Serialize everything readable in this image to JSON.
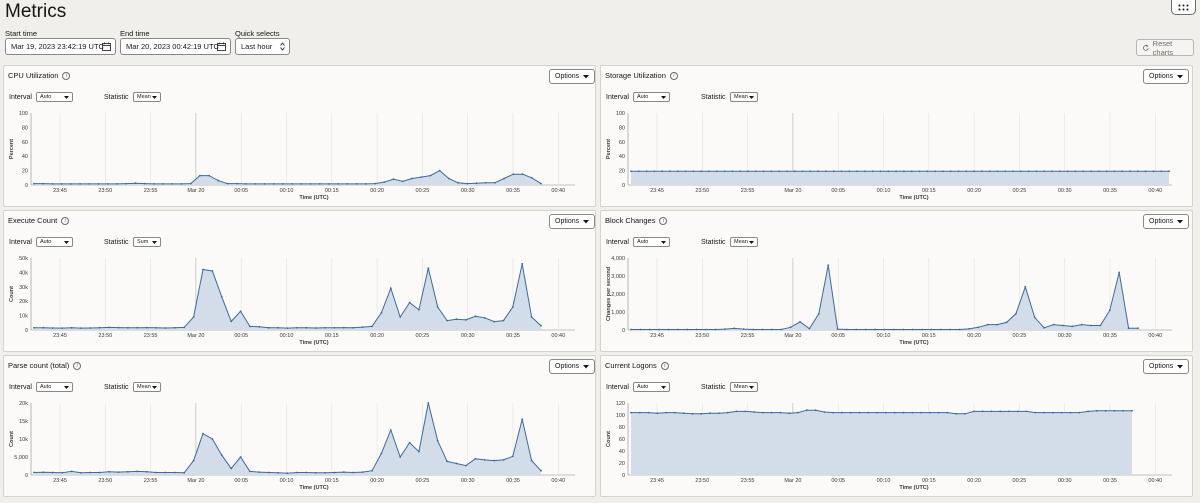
{
  "page": {
    "title": "Metrics"
  },
  "filters": {
    "start_label": "Start time",
    "start_value": "Mar 19, 2023 23:42:19 UTC",
    "end_label": "End time",
    "end_value": "Mar 20, 2023 00:42:19 UTC",
    "quick_label": "Quick selects",
    "quick_value": "Last hour",
    "reset_label": "Reset charts"
  },
  "time_axis": {
    "title": "Time (UTC)",
    "ticks": [
      "23:45",
      "23:50",
      "23:55",
      "Mar 20",
      "00:05",
      "00:10",
      "00:15",
      "00:20",
      "00:25",
      "00:30",
      "00:35",
      "00:40"
    ]
  },
  "panels": [
    {
      "id": "cpu",
      "title": "CPU Utilization",
      "options_label": "Options",
      "interval_label": "Interval",
      "interval_value": "Auto",
      "statistic_label": "Statistic",
      "statistic_value": "Mean",
      "chart_data": {
        "type": "area",
        "ylabel": "Percent",
        "ylim": [
          0,
          100
        ],
        "yticks": [
          "100",
          "80",
          "60",
          "40",
          "20",
          "0"
        ],
        "yvals": [
          100,
          80,
          60,
          40,
          20,
          0
        ],
        "values": [
          2,
          2,
          1.5,
          1.5,
          1.5,
          1.5,
          1.5,
          1.5,
          1.5,
          1.5,
          2,
          2.5,
          2,
          1.5,
          1.5,
          1.5,
          1.5,
          2,
          13,
          13,
          6,
          2,
          2,
          1.5,
          1.5,
          1.5,
          1.5,
          1.5,
          1.5,
          1.5,
          1.5,
          1.5,
          1.5,
          1.5,
          1.5,
          1.5,
          1.5,
          2,
          4,
          8,
          5,
          9,
          11,
          13,
          20,
          9,
          3,
          2,
          2.5,
          3,
          3,
          9,
          15,
          15,
          10,
          2
        ]
      }
    },
    {
      "id": "storage",
      "title": "Storage Utilization",
      "options_label": "Options",
      "interval_label": "Interval",
      "interval_value": "Auto",
      "statistic_label": "Statistic",
      "statistic_value": "Mean",
      "chart_data": {
        "type": "area",
        "ylabel": "Percent",
        "ylim": [
          0,
          100
        ],
        "yticks": [
          "100",
          "80",
          "60",
          "40",
          "20",
          "0"
        ],
        "yvals": [
          100,
          80,
          60,
          40,
          20,
          0
        ],
        "values": [
          19,
          19,
          19,
          19,
          19,
          19,
          19,
          19,
          19,
          19,
          19,
          19,
          19,
          19,
          19,
          19,
          19,
          19,
          19,
          19,
          19,
          19,
          19,
          19,
          19,
          19,
          19,
          19,
          19,
          19,
          19,
          19,
          19,
          19,
          19,
          19,
          19,
          19,
          19,
          19,
          19,
          19,
          19,
          19,
          19,
          19,
          19,
          19,
          19,
          19,
          19,
          19,
          19,
          19,
          19,
          19,
          19,
          19,
          19,
          19,
          19,
          19,
          19,
          19,
          19,
          19,
          19,
          19,
          19,
          19
        ]
      }
    },
    {
      "id": "execute",
      "title": "Execute Count",
      "options_label": "Options",
      "interval_label": "Interval",
      "interval_value": "Auto",
      "statistic_label": "Statistic",
      "statistic_value": "Sum",
      "chart_data": {
        "type": "area",
        "ylabel": "Count",
        "ylim": [
          0,
          50000
        ],
        "yticks": [
          "50k",
          "40k",
          "30k",
          "20k",
          "10k",
          "0"
        ],
        "yvals": [
          50000,
          40000,
          30000,
          20000,
          10000,
          0
        ],
        "values": [
          1500,
          1600,
          1400,
          1300,
          1500,
          1300,
          1400,
          1600,
          1800,
          1700,
          1500,
          1600,
          1700,
          1500,
          1400,
          1500,
          1800,
          9000,
          42000,
          41000,
          23000,
          6000,
          13000,
          2500,
          2200,
          1500,
          1500,
          1300,
          1500,
          1500,
          1400,
          1500,
          1500,
          1700,
          1500,
          2000,
          2500,
          12000,
          29000,
          9000,
          19000,
          14000,
          43000,
          16000,
          6500,
          7500,
          7000,
          9500,
          8500,
          5800,
          6500,
          16000,
          46000,
          9000,
          3000
        ]
      }
    },
    {
      "id": "block",
      "title": "Block Changes",
      "options_label": "Options",
      "interval_label": "Interval",
      "interval_value": "Auto",
      "statistic_label": "Statistic",
      "statistic_value": "Mean",
      "chart_data": {
        "type": "area",
        "ylabel": "Changes per second",
        "ylim": [
          0,
          4000
        ],
        "yticks": [
          "4,000",
          "3,000",
          "2,000",
          "1,000",
          "0"
        ],
        "yvals": [
          4000,
          3000,
          2000,
          1000,
          0
        ],
        "values": [
          30,
          30,
          30,
          30,
          30,
          30,
          30,
          30,
          30,
          30,
          50,
          90,
          50,
          30,
          30,
          30,
          30,
          150,
          450,
          80,
          900,
          3600,
          50,
          30,
          30,
          30,
          30,
          30,
          30,
          30,
          30,
          30,
          30,
          30,
          30,
          30,
          60,
          150,
          300,
          300,
          420,
          900,
          2400,
          700,
          120,
          300,
          250,
          200,
          300,
          250,
          250,
          1100,
          3200,
          100,
          100
        ]
      }
    },
    {
      "id": "parse",
      "title": "Parse count (total)",
      "options_label": "Options",
      "interval_label": "Interval",
      "interval_value": "Auto",
      "statistic_label": "Statistic",
      "statistic_value": "Mean",
      "chart_data": {
        "type": "area",
        "ylabel": "Count",
        "ylim": [
          0,
          20000
        ],
        "yticks": [
          "20k",
          "15k",
          "10k",
          "5,000",
          "0"
        ],
        "yvals": [
          20000,
          15000,
          10000,
          5000,
          0
        ],
        "values": [
          700,
          750,
          700,
          650,
          1000,
          600,
          700,
          700,
          900,
          800,
          900,
          1000,
          900,
          700,
          700,
          700,
          600,
          4000,
          11500,
          10000,
          5500,
          1800,
          5000,
          1000,
          800,
          700,
          600,
          500,
          700,
          700,
          600,
          600,
          700,
          800,
          700,
          800,
          1200,
          6000,
          12500,
          5000,
          9000,
          6500,
          20000,
          9500,
          3800,
          3200,
          2600,
          4500,
          4200,
          4000,
          4200,
          5200,
          15500,
          4000,
          1200
        ]
      }
    },
    {
      "id": "logons",
      "title": "Current Logons",
      "options_label": "Options",
      "interval_label": "Interval",
      "interval_value": "Auto",
      "statistic_label": "Statistic",
      "statistic_value": "Mean",
      "chart_data": {
        "type": "area",
        "ylabel": "Count",
        "ylim": [
          0,
          120
        ],
        "yticks": [
          "120",
          "100",
          "80",
          "60",
          "40",
          "20",
          "0"
        ],
        "yvals": [
          120,
          100,
          80,
          60,
          40,
          20,
          0
        ],
        "values": [
          104,
          104,
          104,
          103,
          104,
          104,
          103,
          102,
          102,
          103,
          103,
          104,
          106,
          106,
          105,
          104,
          104,
          104,
          103,
          104,
          108,
          108,
          105,
          104,
          104,
          104,
          104,
          104,
          104,
          104,
          104,
          104,
          104,
          104,
          104,
          104,
          104,
          102,
          102,
          106,
          106,
          106,
          106,
          106,
          106,
          106,
          104,
          104,
          104,
          104,
          104,
          104,
          106,
          107,
          107,
          107,
          107,
          107
        ]
      }
    }
  ]
}
